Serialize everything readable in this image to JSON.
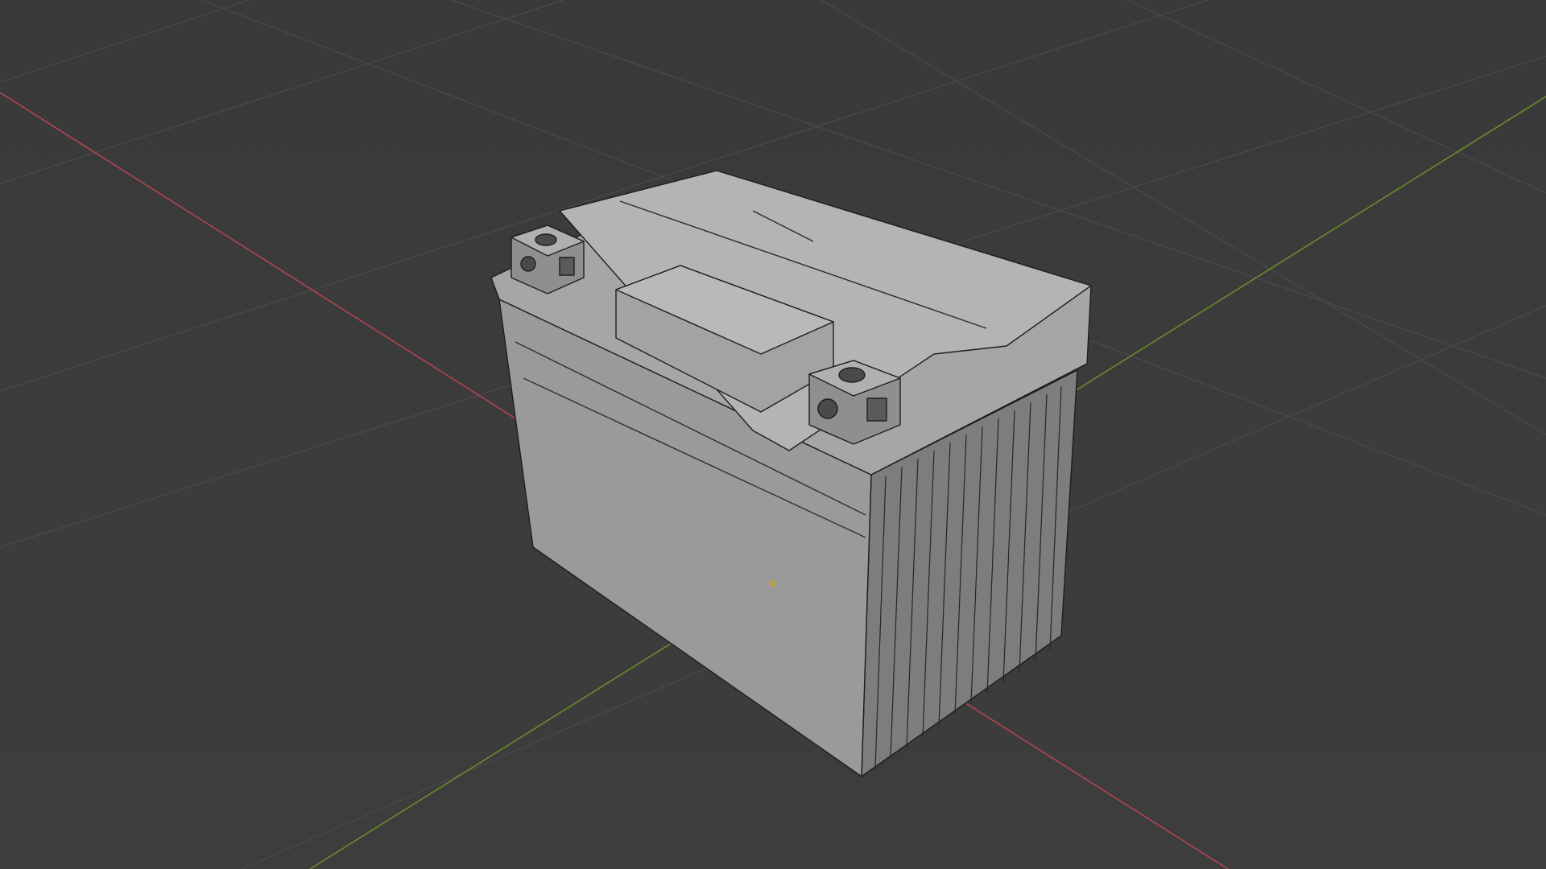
{
  "viewport": {
    "mode": "solid",
    "overlay_wireframe": true,
    "background_color": "#3d3d3d",
    "grid_color": "#4a4a4a",
    "x_axis_color": "#b24550",
    "y_axis_color": "#6b8c2a",
    "object_color": "#9a9a9a",
    "origin_color": "#e0a100"
  },
  "scene": {
    "object_name": "battery",
    "terminals": [
      "negative-terminal",
      "positive-terminal"
    ],
    "side_ribs": 12
  }
}
